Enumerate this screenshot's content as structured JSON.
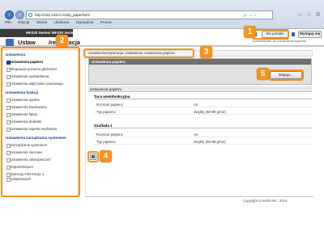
{
  "browser": {
    "address": "http://192.168.0.215/p_paperhtml",
    "address_controls": "ρ - ☆ ☆",
    "menu": [
      "Plik",
      "Edycja",
      "Widok",
      "Ulubione",
      "Narzędzia",
      "Pomoc"
    ],
    "tab_title": "MF220 Series/ MF220 Series/"
  },
  "header": {
    "device_title_part1": "Ustaw",
    "device_title_part2": "/rejestracja",
    "top_link_portal": "Do portalu",
    "top_link_logout": "Wyloguj się",
    "admin_subtitle": "Administrator do menedżera systemu"
  },
  "sidebar": {
    "sections": [
      {
        "title": "Ustawienia",
        "items": [
          {
            "label": "Ustawienia papieru",
            "selected": true
          },
          {
            "label": "Regulacja poziomu głośności",
            "selected": false
          },
          {
            "label": "Ustawienia wyświetlania",
            "selected": false
          },
          {
            "label": "Ustawienia włącznika czasowego",
            "selected": false
          }
        ]
      },
      {
        "title": "Ustawienia funkcji",
        "items": [
          {
            "label": "Ustawienia ogólne",
            "selected": false
          },
          {
            "label": "Ustawienia kopiowania",
            "selected": false
          },
          {
            "label": "Ustawienia faksu",
            "selected": false
          },
          {
            "label": "Ustawienia drukarki",
            "selected": false
          },
          {
            "label": "Ustawienia raportu wydruków",
            "selected": false
          }
        ]
      },
      {
        "title": "Ustawienia zarządzania systemem",
        "items": [
          {
            "label": "Zarządzanie systemem",
            "selected": false
          },
          {
            "label": "Ustawienia sieciowe",
            "selected": false
          },
          {
            "label": "Ustawienia zabezpieczeń",
            "selected": false
          },
          {
            "label": "Import/eksport",
            "selected": false
          },
          {
            "label": "Zainicjuj informację o",
            "selected": false
          },
          {
            "label": "ustawieniach",
            "selected": false
          }
        ]
      }
    ]
  },
  "main": {
    "breadcrumb": "Ustawienia/rejestracja: Ustawienia: Ustawienia papieru",
    "panel_title": "Ustawienia papieru",
    "edit_button": "Edycja...",
    "section_title": "Ustawienia papieru",
    "groups": [
      {
        "title": "Taca wielofunkcyjna",
        "rows": [
          {
            "label": "Rozmiar papieru:",
            "value": "A4"
          },
          {
            "label": "Typ papieru:",
            "value": "Zwykły (60-89 g/m2)"
          }
        ]
      },
      {
        "title": "Szuflada 1",
        "rows": [
          {
            "label": "Rozmiar papieru:",
            "value": "A4"
          },
          {
            "label": "Typ papieru:",
            "value": "Zwykły (60-89 g/m2)"
          }
        ]
      }
    ],
    "copyright": "Copyright CANON INC. 2014"
  },
  "callouts": [
    "1",
    "2",
    "3",
    "4",
    "5"
  ],
  "colors": {
    "callout": "#f7931d",
    "nav_section": "#1c3e86",
    "panel_header": "#6f6f6f"
  }
}
